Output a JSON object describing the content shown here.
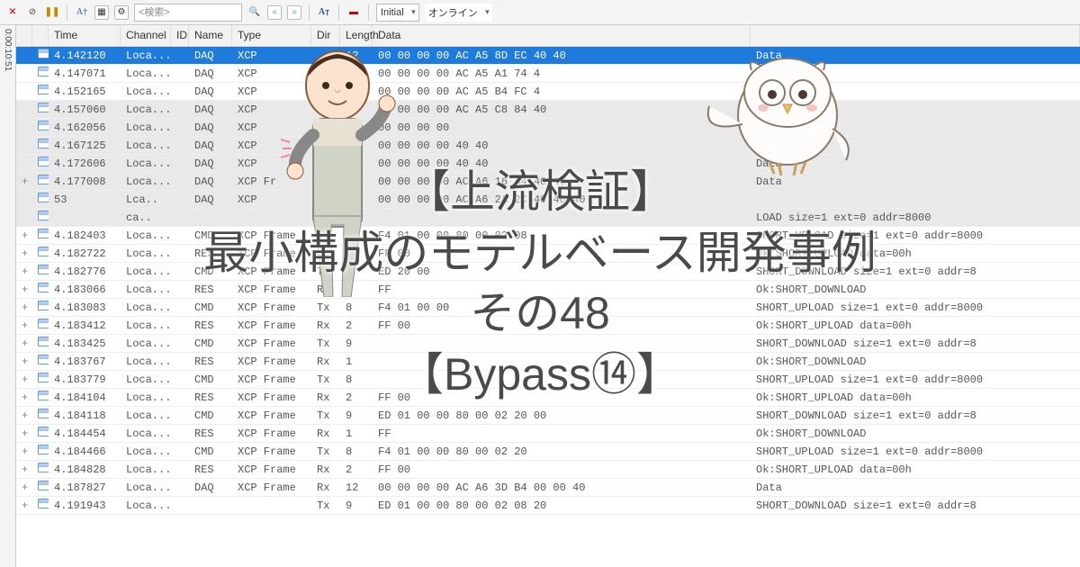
{
  "toolbar": {
    "search_placeholder": "<検索>",
    "initial_label": "Initial",
    "online_label": "オンライン"
  },
  "sideruler": "0:00:10:51",
  "columns": {
    "time": "Time",
    "channel": "Channel",
    "id": "ID",
    "name": "Name",
    "type": "Type",
    "dir": "Dir",
    "length": "Length",
    "data": "Data"
  },
  "rows": [
    {
      "exp": "",
      "sel": true,
      "shade": false,
      "time": "4.142120",
      "chan": "Loca...",
      "name": "DAQ",
      "type": "XCP",
      "dir": "",
      "len": "12",
      "data": "00 00 00 00  AC A5 8D EC 40 40",
      "desc": "Data"
    },
    {
      "exp": "",
      "sel": false,
      "shade": false,
      "time": "4.147071",
      "chan": "Loca...",
      "name": "DAQ",
      "type": "XCP",
      "dir": "",
      "len": "12",
      "data": "00 00 00 00  AC A5 A1 74 4",
      "desc": "Data"
    },
    {
      "exp": "",
      "sel": false,
      "shade": false,
      "time": "4.152165",
      "chan": "Loca...",
      "name": "DAQ",
      "type": "XCP",
      "dir": "",
      "len": "12",
      "data": "00 00 00 00  AC A5 B4 FC 4",
      "desc": "Data"
    },
    {
      "exp": "",
      "sel": false,
      "shade": true,
      "time": "4.157060",
      "chan": "Loca...",
      "name": "DAQ",
      "type": "XCP",
      "dir": "",
      "len": "12",
      "data": "00 00 00 00  AC A5 C8 84 40",
      "desc": "Data"
    },
    {
      "exp": "",
      "sel": false,
      "shade": true,
      "time": "4.162056",
      "chan": "Loca...",
      "name": "DAQ",
      "type": "XCP",
      "dir": "",
      "len": "12",
      "data": "00 00 00 00",
      "desc": "Data"
    },
    {
      "exp": "",
      "sel": false,
      "shade": true,
      "time": "4.167125",
      "chan": "Loca...",
      "name": "DAQ",
      "type": "XCP",
      "dir": "",
      "len": "12",
      "data": "00 00 00 00         40 40",
      "desc": "Data"
    },
    {
      "exp": "",
      "sel": false,
      "shade": true,
      "time": "4.172606",
      "chan": "Loca...",
      "name": "DAQ",
      "type": "XCP",
      "dir": "",
      "len": "12",
      "data": "00 00 00 00         40 40",
      "desc": "Data"
    },
    {
      "exp": "+",
      "sel": false,
      "shade": true,
      "time": "4.177008",
      "chan": "Loca...",
      "name": "DAQ",
      "type": "XCP Fr",
      "dir": "Tx",
      "len": "12",
      "data": "00 00 00 00  AC A6 16 A4 40 40",
      "desc": "Data"
    },
    {
      "exp": "",
      "sel": false,
      "shade": true,
      "time": "53",
      "chan": "Lca..",
      "name": "DAQ",
      "type": "XCP",
      "dir": "",
      "len": "12",
      "data": "00 00 00 00  AC A6 2A 2C 40 40 40",
      "desc": ""
    },
    {
      "exp": "",
      "sel": false,
      "shade": true,
      "time": "",
      "chan": "ca..",
      "name": "",
      "type": "",
      "dir": "",
      "len": "",
      "data": "",
      "desc": "LOAD size=1 ext=0 addr=8000"
    },
    {
      "exp": "+",
      "sel": false,
      "shade": false,
      "time": "4.182403",
      "chan": "Loca...",
      "name": "CMD",
      "type": "XCP Frame",
      "dir": "Tx",
      "len": "8",
      "data": "F4 01 00 00  80 00 02 08",
      "desc": "SHORT_UPLOAD size=1 ext=0 addr=8000"
    },
    {
      "exp": "+",
      "sel": false,
      "shade": false,
      "time": "4.182722",
      "chan": "Loca...",
      "name": "RES",
      "type": "XCP Frame",
      "dir": "Rx",
      "len": "2",
      "data": "FF 00",
      "desc": "Ok:SHORT_UPLOAD data=00h"
    },
    {
      "exp": "+",
      "sel": false,
      "shade": false,
      "time": "4.182776",
      "chan": "Loca...",
      "name": "CMD",
      "type": "XCP Frame",
      "dir": "Tx",
      "len": "9",
      "data": "ED                  20 00",
      "desc": "SHORT_DOWNLOAD size=1 ext=0 addr=8"
    },
    {
      "exp": "+",
      "sel": false,
      "shade": false,
      "time": "4.183066",
      "chan": "Loca...",
      "name": "RES",
      "type": "XCP Frame",
      "dir": "Rx",
      "len": "1",
      "data": "FF",
      "desc": "Ok:SHORT_DOWNLOAD"
    },
    {
      "exp": "+",
      "sel": false,
      "shade": false,
      "time": "4.183083",
      "chan": "Loca...",
      "name": "CMD",
      "type": "XCP Frame",
      "dir": "Tx",
      "len": "8",
      "data": "F4 01 00 00",
      "desc": "SHORT_UPLOAD size=1 ext=0 addr=8000"
    },
    {
      "exp": "+",
      "sel": false,
      "shade": false,
      "time": "4.183412",
      "chan": "Loca...",
      "name": "RES",
      "type": "XCP Frame",
      "dir": "Rx",
      "len": "2",
      "data": "FF 00",
      "desc": "Ok:SHORT_UPLOAD data=00h"
    },
    {
      "exp": "+",
      "sel": false,
      "shade": false,
      "time": "4.183425",
      "chan": "Loca...",
      "name": "CMD",
      "type": "XCP Frame",
      "dir": "Tx",
      "len": "9",
      "data": "",
      "desc": "SHORT_DOWNLOAD size=1 ext=0 addr=8"
    },
    {
      "exp": "+",
      "sel": false,
      "shade": false,
      "time": "4.183767",
      "chan": "Loca...",
      "name": "RES",
      "type": "XCP Frame",
      "dir": "Rx",
      "len": "1",
      "data": "",
      "desc": "Ok:SHORT_DOWNLOAD"
    },
    {
      "exp": "+",
      "sel": false,
      "shade": false,
      "time": "4.183779",
      "chan": "Loca...",
      "name": "CMD",
      "type": "XCP Frame",
      "dir": "Tx",
      "len": "8",
      "data": "",
      "desc": "SHORT_UPLOAD size=1 ext=0 addr=8000"
    },
    {
      "exp": "+",
      "sel": false,
      "shade": false,
      "time": "4.184104",
      "chan": "Loca...",
      "name": "RES",
      "type": "XCP Frame",
      "dir": "Rx",
      "len": "2",
      "data": "FF 00",
      "desc": "Ok:SHORT_UPLOAD data=00h"
    },
    {
      "exp": "+",
      "sel": false,
      "shade": false,
      "time": "4.184118",
      "chan": "Loca...",
      "name": "CMD",
      "type": "XCP Frame",
      "dir": "Tx",
      "len": "9",
      "data": "ED 01 00 00  80 00 02 20 00",
      "desc": "SHORT_DOWNLOAD size=1 ext=0 addr=8"
    },
    {
      "exp": "+",
      "sel": false,
      "shade": false,
      "time": "4.184454",
      "chan": "Loca...",
      "name": "RES",
      "type": "XCP Frame",
      "dir": "Rx",
      "len": "1",
      "data": "FF",
      "desc": "Ok:SHORT_DOWNLOAD"
    },
    {
      "exp": "+",
      "sel": false,
      "shade": false,
      "time": "4.184466",
      "chan": "Loca...",
      "name": "CMD",
      "type": "XCP Frame",
      "dir": "Tx",
      "len": "8",
      "data": "F4 01 00 00  80 00 02 20",
      "desc": "SHORT_UPLOAD size=1 ext=0 addr=8000"
    },
    {
      "exp": "+",
      "sel": false,
      "shade": false,
      "time": "4.184828",
      "chan": "Loca...",
      "name": "RES",
      "type": "XCP Frame",
      "dir": "Rx",
      "len": "2",
      "data": "FF 00",
      "desc": "Ok:SHORT_UPLOAD data=00h"
    },
    {
      "exp": "+",
      "sel": false,
      "shade": false,
      "time": "4.187827",
      "chan": "Loca...",
      "name": "DAQ",
      "type": "XCP Frame",
      "dir": "Rx",
      "len": "12",
      "data": "00 00 00 00  AC A6 3D B4 00 00 40",
      "desc": "Data"
    },
    {
      "exp": "+",
      "sel": false,
      "shade": false,
      "time": "4.191943",
      "chan": "Loca...",
      "name": "",
      "type": "",
      "dir": "Tx",
      "len": "9",
      "data": "ED 01 00 00  80 00 02 08 20",
      "desc": "SHORT_DOWNLOAD size=1 ext=0 addr=8"
    }
  ],
  "overlay": {
    "l1": "【上流検証】",
    "l2": "最小構成のモデルベース開発事例",
    "l3": "その48",
    "l4": "【Bypass⑭】"
  }
}
